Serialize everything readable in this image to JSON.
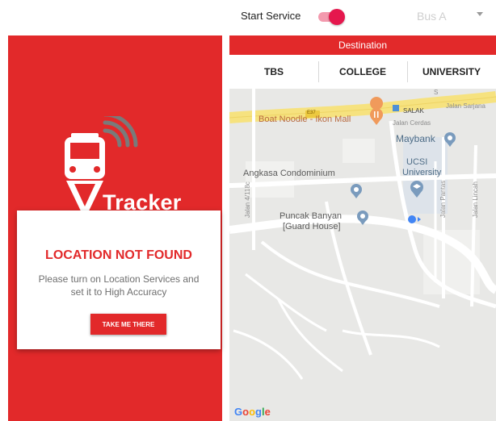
{
  "splash": {
    "app_name": "Tracker",
    "card_title": "LOCATION NOT FOUND",
    "card_message": "Please turn on Location Services and set it to High Accuracy",
    "card_button": "TAKE ME THERE"
  },
  "top_bar": {
    "start_service_label": "Start Service",
    "start_service_on": true,
    "bus_selected": "Bus A"
  },
  "destination": {
    "title": "Destination",
    "tabs": [
      "TBS",
      "COLLEGE",
      "UNIVERSITY"
    ]
  },
  "map": {
    "labels": {
      "boat_noodle": "Boat Noodle - Ikon Mall",
      "salak": "SALAK",
      "jalan_sarjana": "Jalan Sarjana",
      "jalan_cerdas": "Jalan Cerdas",
      "maybank": "Maybank",
      "ucsi_1": "UCSI",
      "ucsi_2": "University",
      "angkasa": "Angkasa Condominium",
      "jalan_4_118c": "Jalan 4/118c",
      "puncak_1": "Puncak Banyan",
      "puncak_2": "[Guard House]",
      "jalan_pantas": "Jalan Pantas",
      "jalan_lincah": "Jalan Lincah",
      "road_shield": "E37",
      "road_s": "S"
    },
    "google": [
      "G",
      "o",
      "o",
      "g",
      "l",
      "e"
    ]
  },
  "colors": {
    "brand_red": "#e2292a",
    "toggle_pink": "#e5174d",
    "map_bg": "#e8e8e6",
    "road_yellow": "#f6e27f"
  },
  "icons": {
    "logo": "bus-signal-pin-icon",
    "restaurant": "fork-knife-pin-icon",
    "bank": "pin-icon",
    "university": "graduation-cap-pin-icon",
    "my_location": "blue-location-dot-icon"
  }
}
